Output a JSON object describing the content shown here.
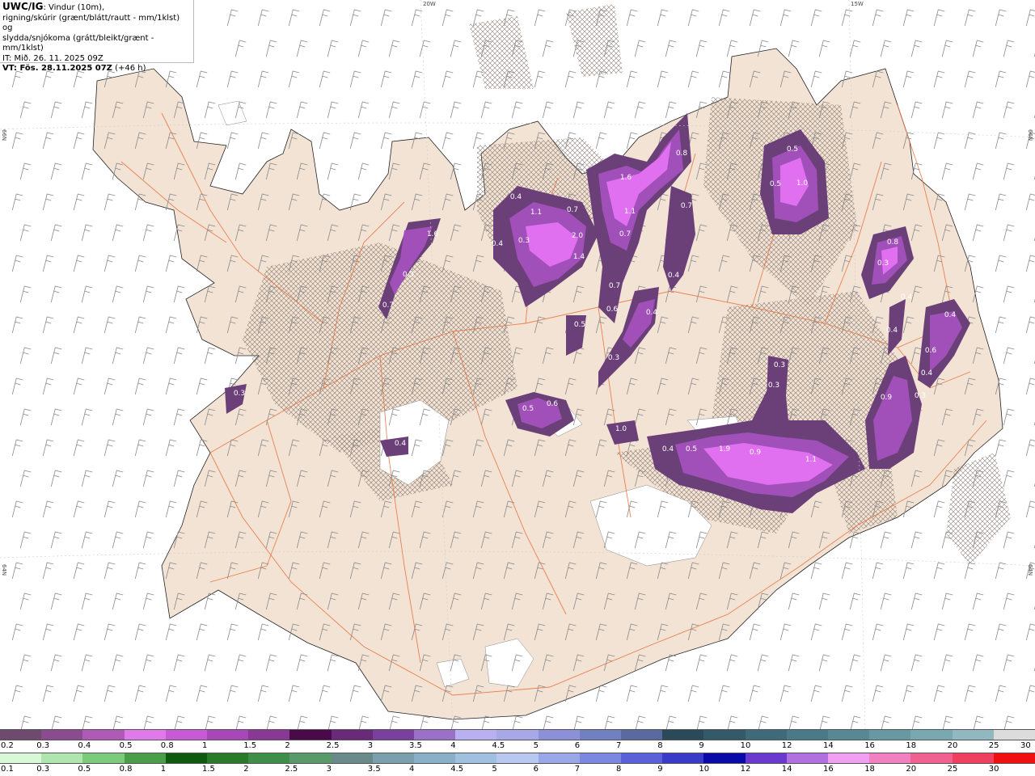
{
  "header": {
    "model": "UWC/IG",
    "line1_rest": ": Vindur (10m),",
    "line2": "rigning/skúrir (grænt/blátt/rautt - mm/1klst) og",
    "line3": "slydda/snjókoma (grátt/bleikt/grænt - mm/1klst)",
    "it": "IT: Mið. 26. 11. 2025 09Z",
    "vt": "VT: Fös. 28.11.2025 07Z",
    "vt_offset": "(+46 h)"
  },
  "graticule": {
    "top_left": "20W",
    "top_right": "15W",
    "left_upper": "66N",
    "left_lower": "64N",
    "right_upper": "66N",
    "right_lower": "64N"
  },
  "colors": {
    "land": "#f2e3d5",
    "sea": "#ffffff",
    "roads": "#e8703a",
    "barbs": "#8a8a8a",
    "precip_dark": "#6b3f78",
    "precip_mid": "#a050b8",
    "precip_light": "#e070f0"
  },
  "precip_labels": [
    "1.6",
    "0.3",
    "0.7",
    "0.3",
    "0.4",
    "1.1",
    "0.7",
    "2.0",
    "1.4",
    "0.4",
    "1.6",
    "1.1",
    "0.7",
    "0.8",
    "0.7",
    "0.7",
    "0.6",
    "0.4",
    "0.5",
    "0.4",
    "0.3",
    "0.5",
    "0.6",
    "1.0",
    "1.0",
    "0.8",
    "0.3",
    "0.4",
    "0.6",
    "0.4",
    "0.3",
    "0.9",
    "0.3",
    "0.3",
    "0.5",
    "0.4",
    "0.5",
    "0.4",
    "0.4",
    "0.5",
    "1.9",
    "0.9",
    "1.1",
    "0.3",
    "0.4"
  ],
  "snow_scale": {
    "ticks": [
      "0.2",
      "0.3",
      "0.4",
      "0.5",
      "0.8",
      "1",
      "1.5",
      "2",
      "2.5",
      "3",
      "3.5",
      "4",
      "4.5",
      "5",
      "6",
      "7",
      "8",
      "9",
      "10",
      "12",
      "14",
      "16",
      "18",
      "20",
      "25",
      "30"
    ],
    "colors": [
      "#6f4a6f",
      "#8b4c8f",
      "#b05ab8",
      "#e07aea",
      "#c85ad6",
      "#a848b8",
      "#8a3896",
      "#4a0a4a",
      "#6a2a7a",
      "#7a40a0",
      "#9a70c8",
      "#b8b0f0",
      "#a8a8e8",
      "#8c90d8",
      "#7080c0",
      "#5a6aa0",
      "#2a4a5a",
      "#345a6a",
      "#3e6a7a",
      "#4a7a88",
      "#588894",
      "#6898a2",
      "#7aa8b0",
      "#90b8be",
      "#dcdcdc"
    ]
  },
  "rain_scale": {
    "ticks": [
      "0.1",
      "0.3",
      "0.5",
      "0.8",
      "1",
      "1.5",
      "2",
      "2.5",
      "3",
      "3.5",
      "4",
      "4.5",
      "5",
      "6",
      "7",
      "8",
      "9",
      "10",
      "12",
      "14",
      "16",
      "18",
      "20",
      "25",
      "30"
    ],
    "colors": [
      "#d8f8d8",
      "#aee6ae",
      "#7cca7c",
      "#4a9e4a",
      "#0e5a0e",
      "#2a7a2a",
      "#3e8e4a",
      "#5a9a6a",
      "#6a8a8a",
      "#7aa0b0",
      "#8ab0c8",
      "#a0c0e0",
      "#b8c8f0",
      "#9aa8e8",
      "#7a88e0",
      "#5a60d8",
      "#3a3ac8",
      "#0a0aa8",
      "#6a3ad0",
      "#b070e0",
      "#f0a0f0",
      "#f080c0",
      "#f06090",
      "#f04060",
      "#f01010"
    ]
  }
}
